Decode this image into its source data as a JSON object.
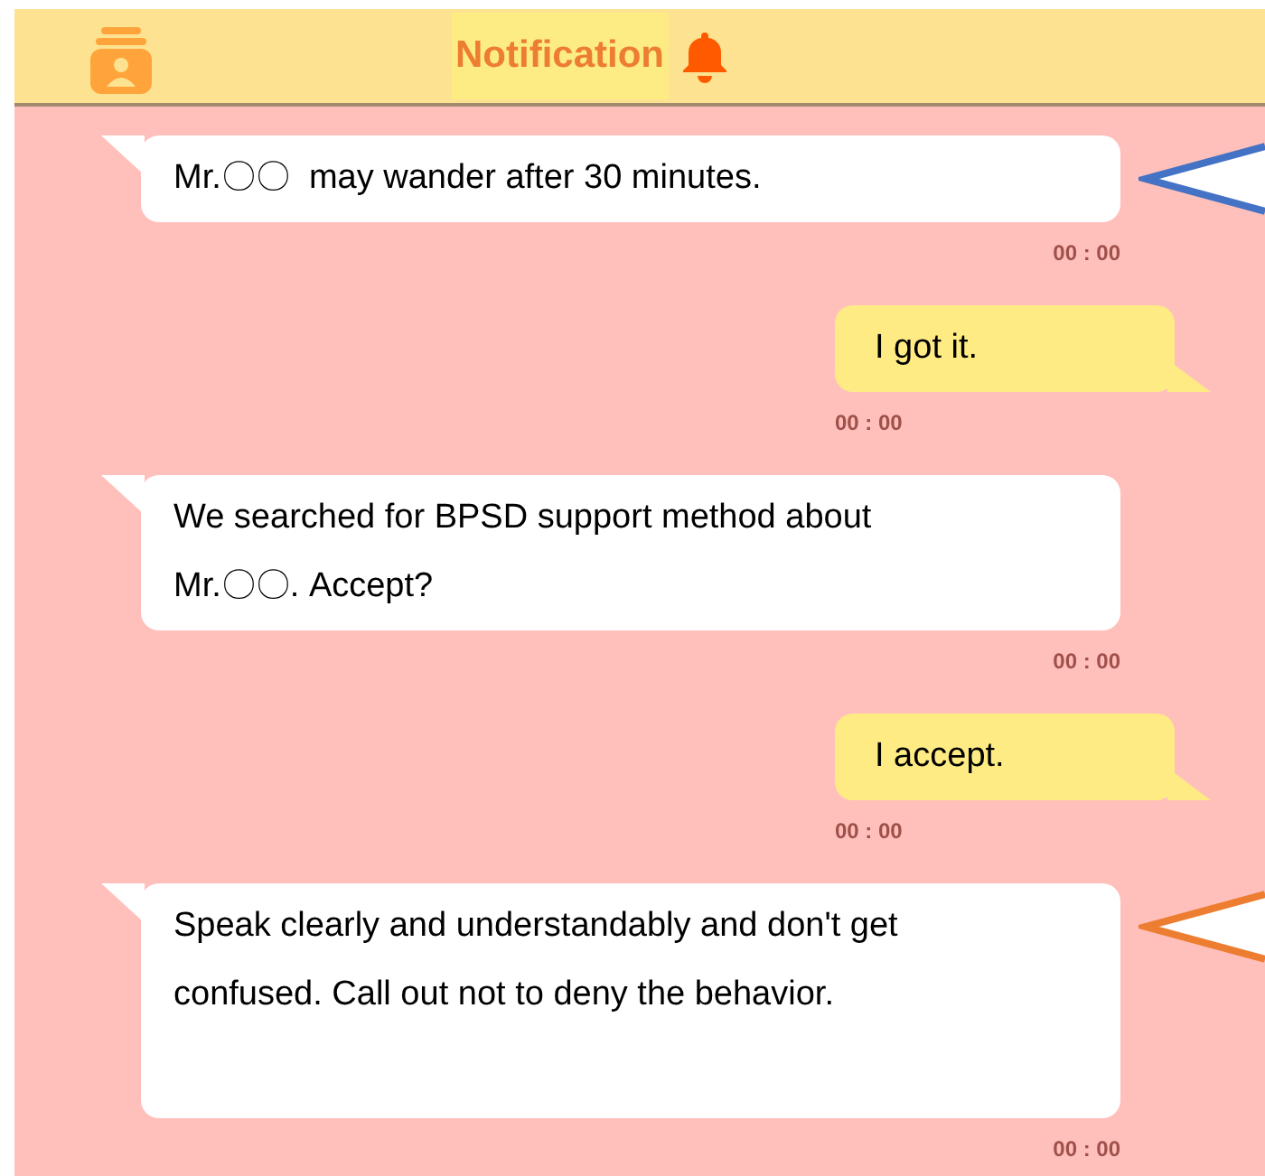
{
  "header": {
    "title": "Notification"
  },
  "messages": [
    {
      "kind": "received",
      "text": "Mr.〇〇  may wander after 30 minutes.",
      "time": "00 : 00",
      "pointer": {
        "color": "#4472c4"
      }
    },
    {
      "kind": "sent",
      "text": "I got it.",
      "time": "00 : 00"
    },
    {
      "kind": "received",
      "text": "We searched for BPSD support method about Mr.〇〇. Accept?",
      "time": "00 : 00"
    },
    {
      "kind": "sent",
      "text": "I accept.",
      "time": "00 : 00"
    },
    {
      "kind": "received",
      "text": "Speak clearly and understandably and don't get confused. Call out not to deny the behavior.",
      "time": "00 : 00",
      "tall": true,
      "pointer": {
        "color": "#ed7d31"
      }
    }
  ]
}
